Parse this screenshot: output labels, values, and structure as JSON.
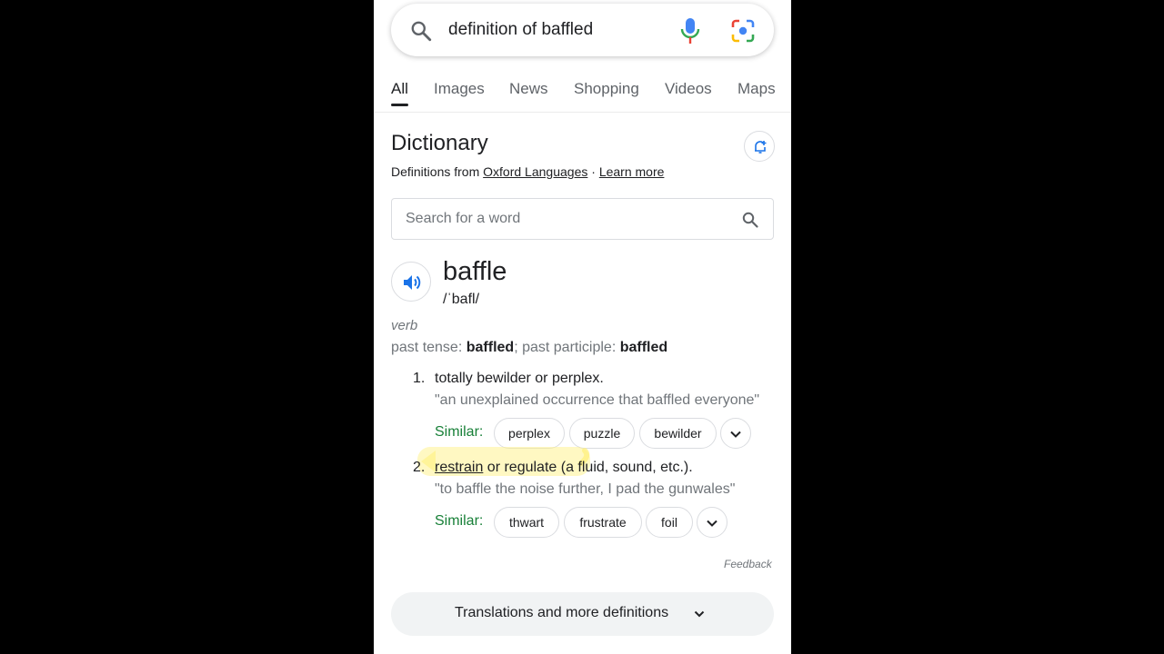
{
  "search": {
    "query": "definition of baffled"
  },
  "tabs": [
    "All",
    "Images",
    "News",
    "Shopping",
    "Videos",
    "Maps"
  ],
  "active_tab": "All",
  "dictionary": {
    "title": "Dictionary",
    "defs_from_prefix": "Definitions from",
    "source": "Oxford Languages",
    "separator": "·",
    "learn_more": "Learn more",
    "search_placeholder": "Search for a word",
    "headword": "baffle",
    "phonetic": "/ˈbafl/",
    "pos": "verb",
    "forms": {
      "past_tense_label": "past tense:",
      "past_tense": "baffled",
      "sep": ";",
      "past_participle_label": "past participle:",
      "past_participle": "baffled"
    },
    "senses": [
      {
        "num": "1.",
        "definition": "totally bewilder or perplex.",
        "example": "\"an unexplained occurrence that baffled everyone\"",
        "similar_label": "Similar:",
        "similar": [
          "perplex",
          "puzzle",
          "bewilder"
        ]
      },
      {
        "num": "2.",
        "definition_link": "restrain",
        "definition_rest": " or regulate (a fluid, sound, etc.).",
        "example": "\"to baffle the noise further, I pad the gunwales\"",
        "similar_label": "Similar:",
        "similar": [
          "thwart",
          "frustrate",
          "foil"
        ]
      }
    ],
    "feedback": "Feedback",
    "more_button": "Translations and more definitions"
  },
  "colors": {
    "similar_green": "#188038",
    "blue": "#1a73e8",
    "highlight": "#fff078"
  }
}
